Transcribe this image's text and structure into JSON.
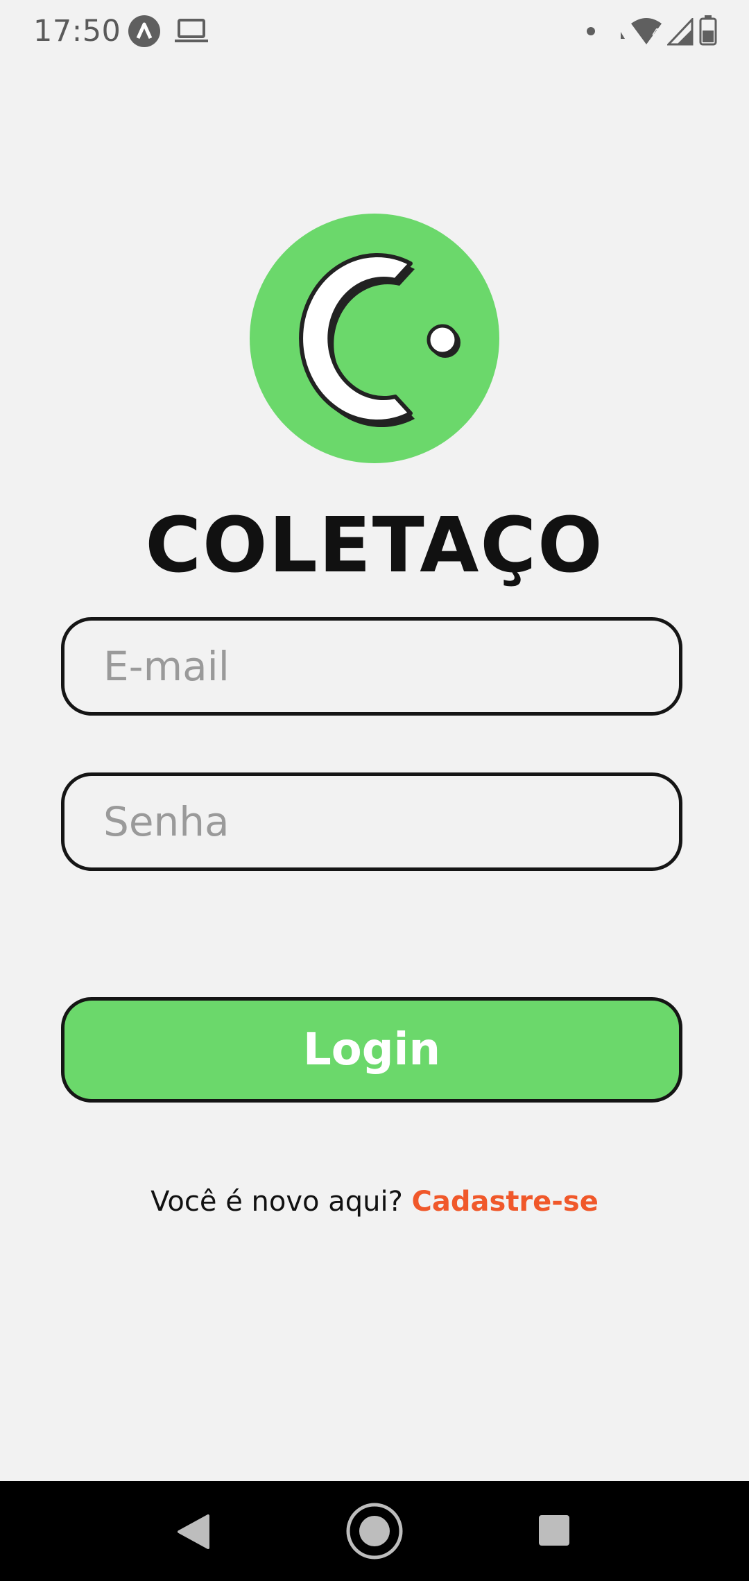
{
  "status_bar": {
    "time": "17:50",
    "icons": [
      "app-notification-icon",
      "laptop-icon",
      "dot-icon",
      "wifi-icon",
      "signal-icon",
      "battery-icon"
    ]
  },
  "brand": {
    "logo_icon": "coletaco-logo-icon",
    "name": "COLETAÇO",
    "accent_color": "#6bd86b"
  },
  "form": {
    "email_placeholder": "E-mail",
    "password_placeholder": "Senha",
    "login_label": "Login"
  },
  "signup": {
    "prompt": "Você é novo aqui?",
    "link_label": "Cadastre-se",
    "link_color": "#f0582a"
  },
  "nav_bar": {
    "icons": [
      "back-icon",
      "home-icon",
      "recents-icon"
    ]
  }
}
